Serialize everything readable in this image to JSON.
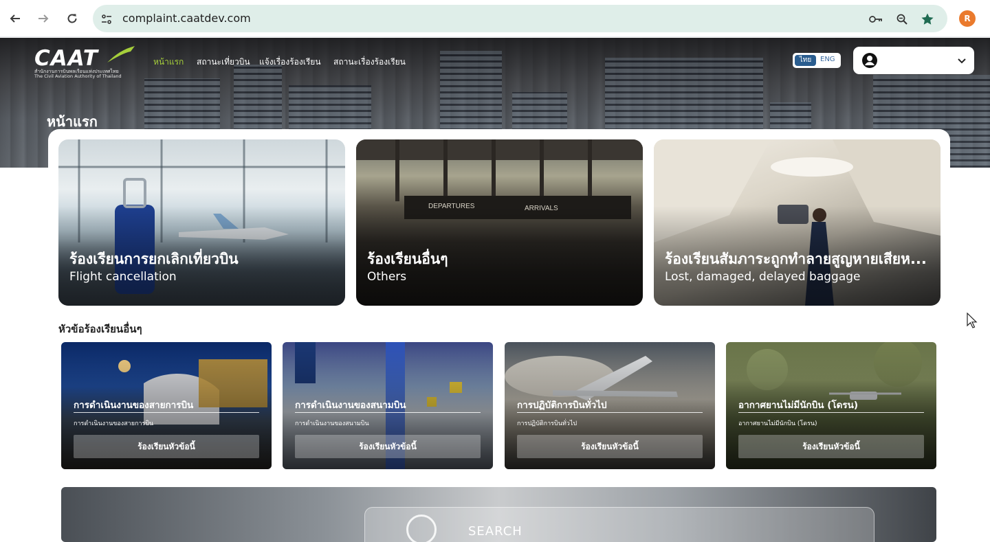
{
  "browser": {
    "url": "complaint.caatdev.com",
    "profile_initial": "R"
  },
  "header": {
    "logo_text": "CAAT",
    "logo_sub_th": "สำนักงานการบินพลเรือนแห่งประเทศไทย",
    "logo_sub_en": "The Civil Aviation Authority of Thailand",
    "nav": [
      {
        "label": "หน้าแรก"
      },
      {
        "label": "สถานะเที่ยวบิน"
      },
      {
        "label": "แจ้งเรื่องร้องเรียน"
      },
      {
        "label": "สถานะเรื่องร้องเรียน"
      }
    ],
    "lang_th": "ไทย",
    "lang_en": "ENG"
  },
  "page": {
    "title": "หน้าแรก"
  },
  "featured": [
    {
      "title_th": "ร้องเรียนการยกเลิกเที่ยวบิน",
      "title_en": "Flight cancellation"
    },
    {
      "title_th": "ร้องเรียนอื่นๆ",
      "title_en": "Others"
    },
    {
      "title_th": "ร้องเรียนสัมภาระถูกทำลายสูญหายเสียห...",
      "title_en": "Lost, damaged, delayed baggage"
    }
  ],
  "other_topics": {
    "heading": "หัวข้อร้องเรียนอื่นๆ",
    "button_label": "ร้องเรียนหัวข้อนี้",
    "items": [
      {
        "title": "การดำเนินงานของสายการบิน",
        "subtitle": "การดำเนินงานของสายการบิน"
      },
      {
        "title": "การดำเนินงานของสนามบิน",
        "subtitle": "การดำเนินงานของสนามบิน"
      },
      {
        "title": "การปฏิบัติการบินทั่วไป",
        "subtitle": "การปฏิบัติการบินทั่วไป"
      },
      {
        "title": "อากาศยานไม่มีนักบิน (โดรน)",
        "subtitle": "อากาศยานไม่มีนักบิน (โดรน)"
      }
    ]
  },
  "search": {
    "label": "SEARCH"
  },
  "colors": {
    "nav_active": "#a6cf3b",
    "lang_active_bg": "#2a5d8f",
    "url_bar_bg": "#dfeee9",
    "profile_avatar": "#ea7a2d"
  }
}
